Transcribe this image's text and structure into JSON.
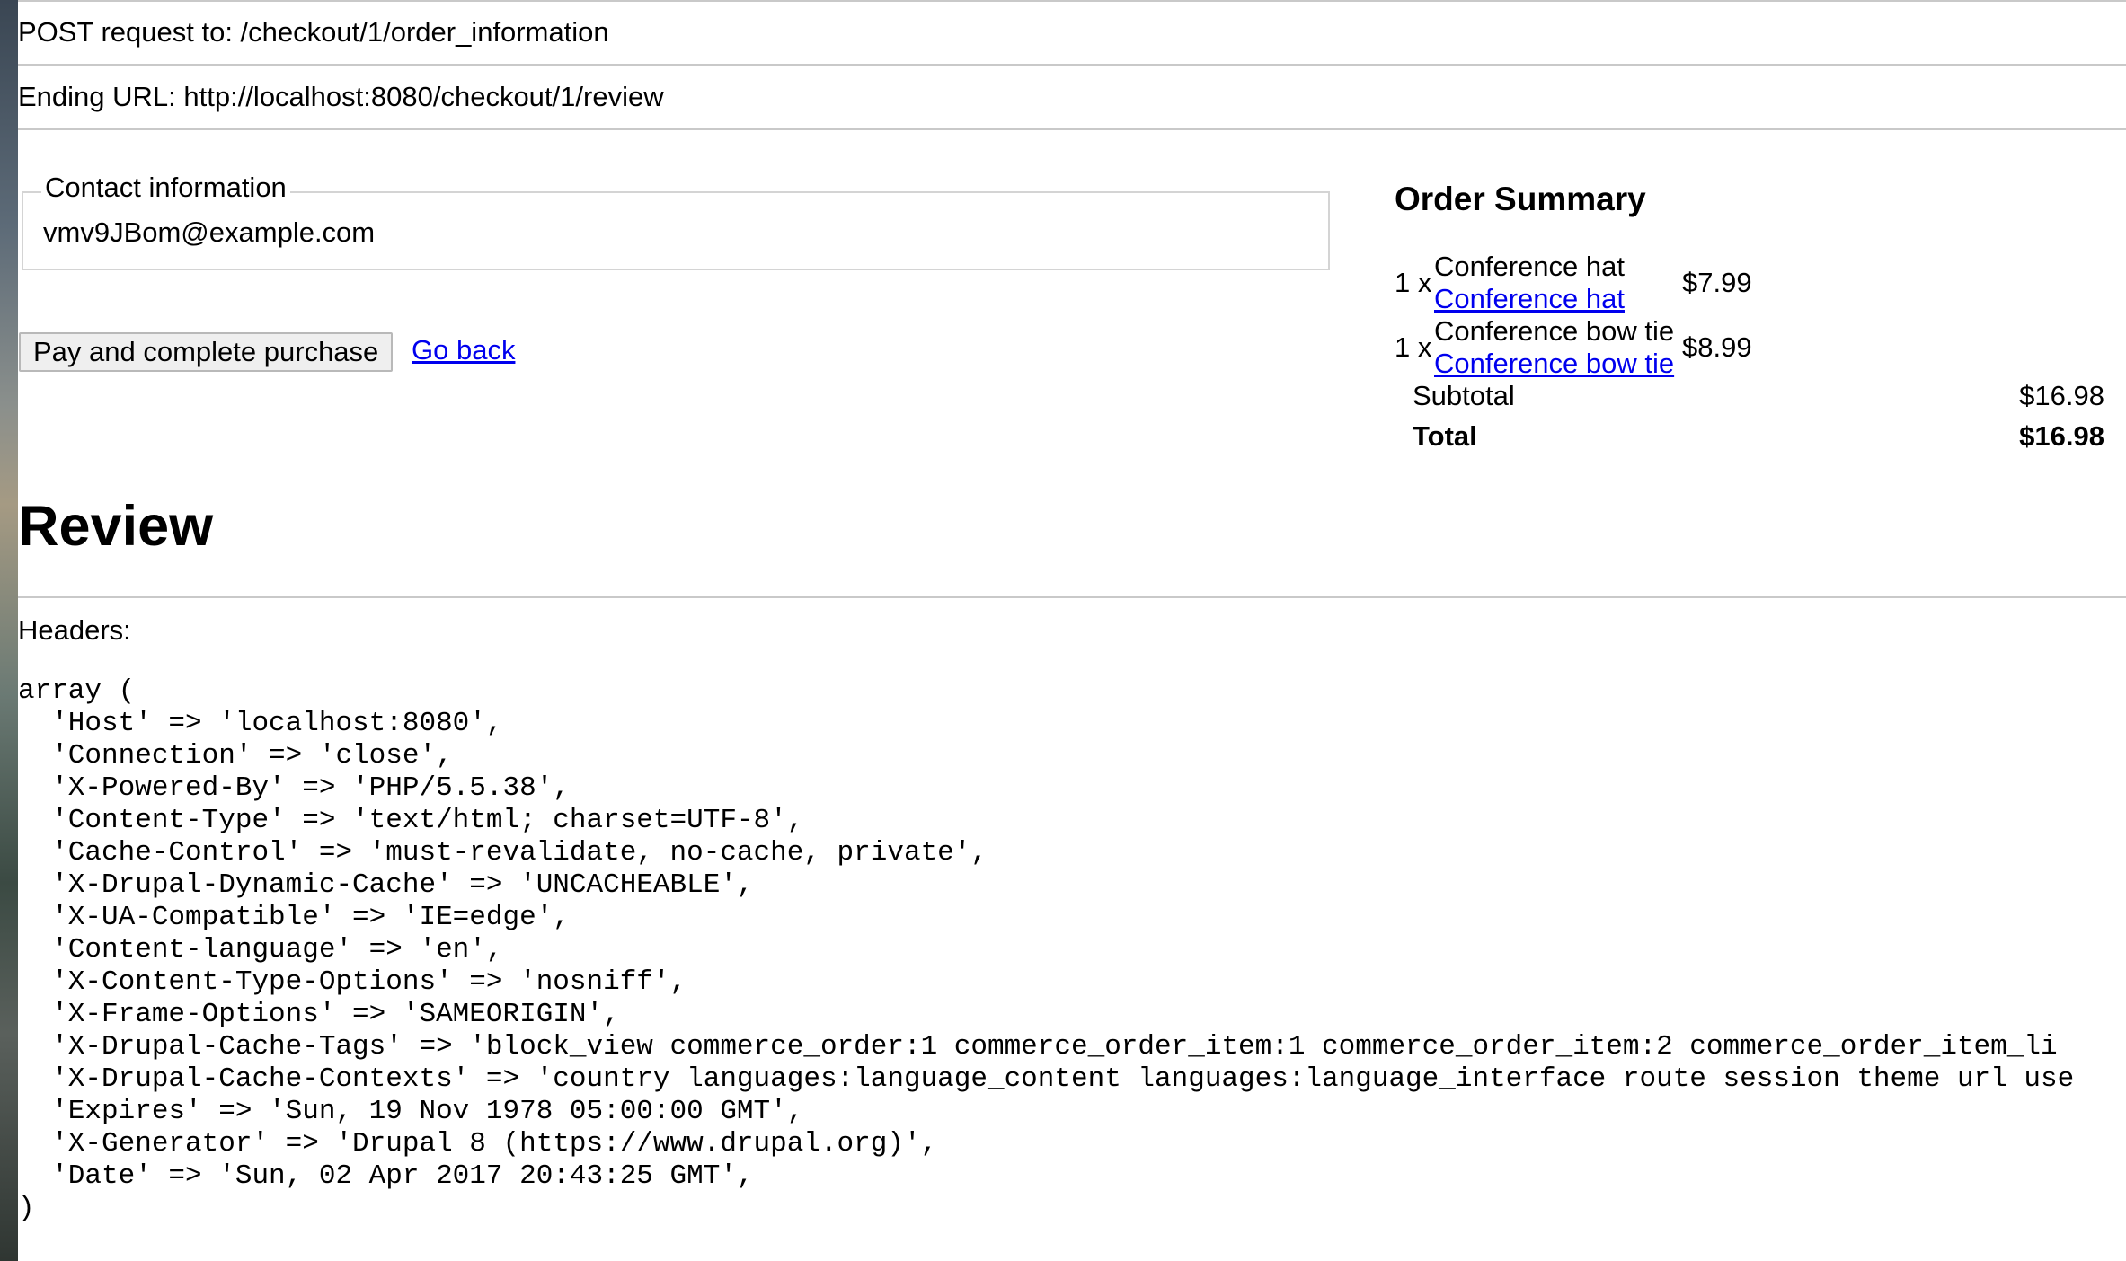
{
  "request": {
    "post_line": "POST request to: /checkout/1/order_information",
    "ending_line": "Ending URL: http://localhost:8080/checkout/1/review"
  },
  "contact": {
    "legend": "Contact information",
    "email": "vmv9JBom@example.com"
  },
  "actions": {
    "pay_button": "Pay and complete purchase",
    "go_back": "Go back"
  },
  "order_summary": {
    "title": "Order Summary",
    "items": [
      {
        "qty": "1 x",
        "title": "Conference hat",
        "link": "Conference hat",
        "price": "$7.99"
      },
      {
        "qty": "1 x",
        "title": "Conference bow tie",
        "link": "Conference bow tie",
        "price": "$8.99"
      }
    ],
    "subtotal_label": "Subtotal",
    "subtotal_value": "$16.98",
    "total_label": "Total",
    "total_value": "$16.98"
  },
  "review": {
    "heading": "Review",
    "headers_label": "Headers:"
  },
  "headers_dump": [
    "array (",
    "  'Host' => 'localhost:8080',",
    "  'Connection' => 'close',",
    "  'X-Powered-By' => 'PHP/5.5.38',",
    "  'Content-Type' => 'text/html; charset=UTF-8',",
    "  'Cache-Control' => 'must-revalidate, no-cache, private',",
    "  'X-Drupal-Dynamic-Cache' => 'UNCACHEABLE',",
    "  'X-UA-Compatible' => 'IE=edge',",
    "  'Content-language' => 'en',",
    "  'X-Content-Type-Options' => 'nosniff',",
    "  'X-Frame-Options' => 'SAMEORIGIN',",
    "  'X-Drupal-Cache-Tags' => 'block_view commerce_order:1 commerce_order_item:1 commerce_order_item:2 commerce_order_item_li",
    "  'X-Drupal-Cache-Contexts' => 'country languages:language_content languages:language_interface route session theme url use",
    "  'Expires' => 'Sun, 19 Nov 1978 05:00:00 GMT',",
    "  'X-Generator' => 'Drupal 8 (https://www.drupal.org)',",
    "  'Date' => 'Sun, 02 Apr 2017 20:43:25 GMT',",
    ")"
  ]
}
